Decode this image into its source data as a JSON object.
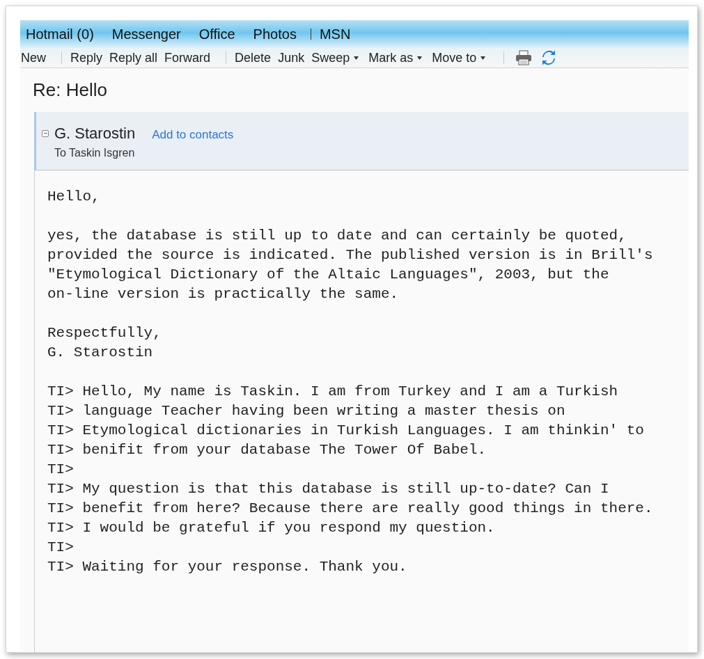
{
  "nav": {
    "groups": [
      [
        "Hotmail (0)",
        "Messenger",
        "Office",
        "Photos"
      ],
      [
        "MSN"
      ]
    ]
  },
  "toolbar": {
    "groups": [
      [
        {
          "label": "New",
          "kind": "button"
        }
      ],
      [
        {
          "label": "Reply",
          "kind": "button"
        },
        {
          "label": "Reply all",
          "kind": "button"
        },
        {
          "label": "Forward",
          "kind": "button"
        }
      ],
      [
        {
          "label": "Delete",
          "kind": "button"
        },
        {
          "label": "Junk",
          "kind": "button"
        },
        {
          "label": "Sweep",
          "kind": "dropdown"
        },
        {
          "label": "Mark as",
          "kind": "dropdown"
        },
        {
          "label": "Move to",
          "kind": "dropdown"
        }
      ]
    ]
  },
  "message": {
    "subject": "Re: Hello",
    "sender": "G. Starostin",
    "add_contact_link": "Add to contacts",
    "recipient_line": "To Taskin Isgren",
    "expanded": true,
    "body": [
      [
        "Hello,"
      ],
      [
        "yes, the database is still up to date and can certainly be quoted,",
        "provided the source is indicated. The published version is in Brill's",
        "\"Etymological Dictionary of the Altaic Languages\", 2003, but the",
        "on-line version is practically the same."
      ],
      [
        "Respectfully,",
        "G. Starostin"
      ],
      [
        "TI> Hello, My name is Taskin. I am from Turkey and I am a Turkish",
        "TI> language Teacher having been writing a master thesis on",
        "TI> Etymological dictionaries in Turkish Languages. I am thinkin' to",
        "TI> benifit from your database The Tower Of Babel.",
        "TI>",
        "TI> My question is that this database is still up-to-date? Can I",
        "TI> benefit from here? Because there are really good things in there.",
        "TI> I would be grateful if you respond my question.",
        "TI>",
        "TI> Waiting for your response. Thank you."
      ]
    ]
  }
}
